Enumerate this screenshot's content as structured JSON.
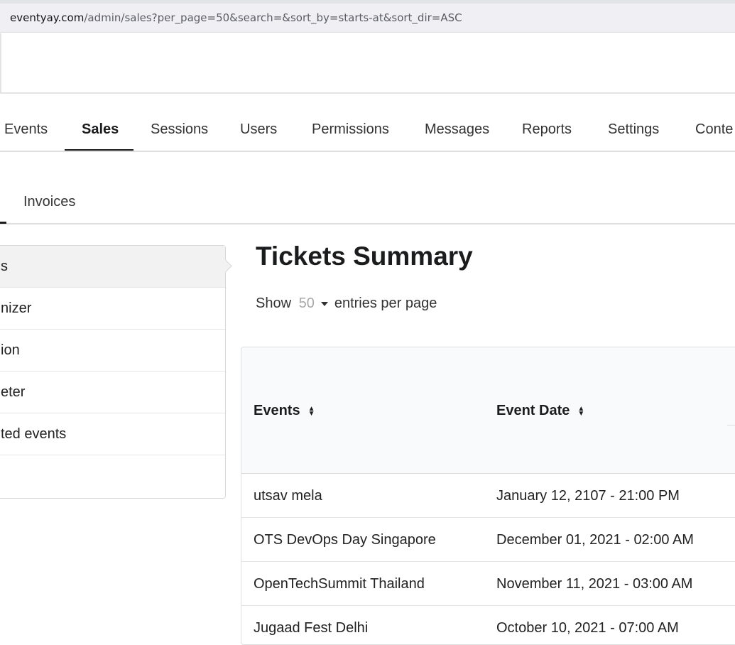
{
  "browser": {
    "url_host": "eventyay.com",
    "url_path": "/admin/sales?per_page=50&search=&sort_by=starts-at&sort_dir=ASC"
  },
  "main_nav": {
    "items": [
      "Events",
      "Sales",
      "Sessions",
      "Users",
      "Permissions",
      "Messages",
      "Reports",
      "Settings",
      "Conte"
    ],
    "active": "Sales"
  },
  "sub_nav": {
    "items": [
      "Invoices"
    ]
  },
  "side_menu": {
    "items": [
      "s",
      "nizer",
      "ion",
      "eter",
      "ted events",
      ""
    ],
    "active_index": 0
  },
  "content": {
    "title": "Tickets Summary",
    "show_label": "Show",
    "per_page_value": "50",
    "entries_label": "entries per page"
  },
  "table": {
    "headers": [
      "Events",
      "Event Date"
    ],
    "rows": [
      [
        "utsav mela",
        "January 12, 2107 - 21:00 PM"
      ],
      [
        "OTS DevOps Day Singapore",
        "December 01, 2021 - 02:00 AM"
      ],
      [
        "OpenTechSummit Thailand",
        "November 11, 2021 - 03:00 AM"
      ],
      [
        "Jugaad Fest Delhi",
        "October 10, 2021 - 07:00 AM"
      ]
    ]
  },
  "icons": {
    "sort": "sort-icon",
    "dropdown": "caret-down-icon"
  }
}
